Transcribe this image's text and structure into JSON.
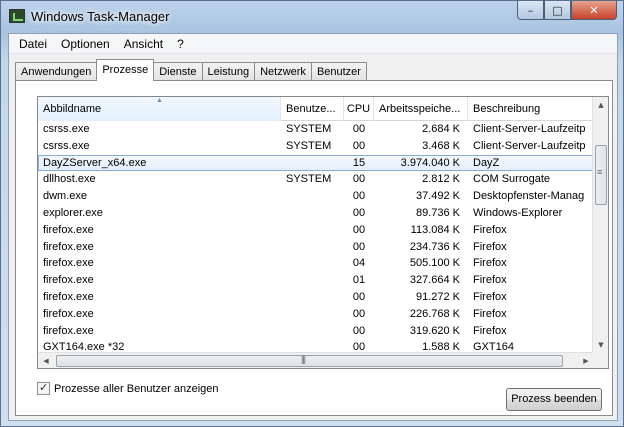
{
  "window": {
    "title": "Windows Task-Manager",
    "min_glyph": "–",
    "max_glyph": "□",
    "close_glyph": "✕"
  },
  "menu": [
    "Datei",
    "Optionen",
    "Ansicht",
    "?"
  ],
  "tabs": [
    "Anwendungen",
    "Prozesse",
    "Dienste",
    "Leistung",
    "Netzwerk",
    "Benutzer"
  ],
  "active_tab": "Prozesse",
  "columns": {
    "name": "Abbildname",
    "user": "Benutze...",
    "cpu": "CPU",
    "mem": "Arbeitsspeiche...",
    "desc": "Beschreibung",
    "sorted": "name"
  },
  "rows": [
    {
      "name": "csrss.exe",
      "user": "SYSTEM",
      "cpu": "00",
      "mem": "2.684 K",
      "desc": "Client-Server-Laufzeitp"
    },
    {
      "name": "csrss.exe",
      "user": "SYSTEM",
      "cpu": "00",
      "mem": "3.468 K",
      "desc": "Client-Server-Laufzeitp"
    },
    {
      "name": "DayZServer_x64.exe",
      "user": "",
      "cpu": "15",
      "mem": "3.974.040 K",
      "desc": "DayZ",
      "selected": true
    },
    {
      "name": "dllhost.exe",
      "user": "SYSTEM",
      "cpu": "00",
      "mem": "2.812 K",
      "desc": "COM Surrogate"
    },
    {
      "name": "dwm.exe",
      "user": "",
      "cpu": "00",
      "mem": "37.492 K",
      "desc": "Desktopfenster-Manag"
    },
    {
      "name": "explorer.exe",
      "user": "",
      "cpu": "00",
      "mem": "89.736 K",
      "desc": "Windows-Explorer"
    },
    {
      "name": "firefox.exe",
      "user": "",
      "cpu": "00",
      "mem": "113.084 K",
      "desc": "Firefox"
    },
    {
      "name": "firefox.exe",
      "user": "",
      "cpu": "00",
      "mem": "234.736 K",
      "desc": "Firefox"
    },
    {
      "name": "firefox.exe",
      "user": "",
      "cpu": "04",
      "mem": "505.100 K",
      "desc": "Firefox"
    },
    {
      "name": "firefox.exe",
      "user": "",
      "cpu": "01",
      "mem": "327.664 K",
      "desc": "Firefox"
    },
    {
      "name": "firefox.exe",
      "user": "",
      "cpu": "00",
      "mem": "91.272 K",
      "desc": "Firefox"
    },
    {
      "name": "firefox.exe",
      "user": "",
      "cpu": "00",
      "mem": "226.768 K",
      "desc": "Firefox"
    },
    {
      "name": "firefox.exe",
      "user": "",
      "cpu": "00",
      "mem": "319.620 K",
      "desc": "Firefox"
    },
    {
      "name": "GXT164.exe *32",
      "user": "",
      "cpu": "00",
      "mem": "1.588 K",
      "desc": "GXT164"
    }
  ],
  "scrollbar": {
    "up": "▲",
    "down": "▼",
    "left": "◀",
    "right": "▶"
  },
  "show_all_users": {
    "label": "Prozesse aller Benutzer anzeigen",
    "checked": true
  },
  "end_process_label": "Prozess beenden"
}
